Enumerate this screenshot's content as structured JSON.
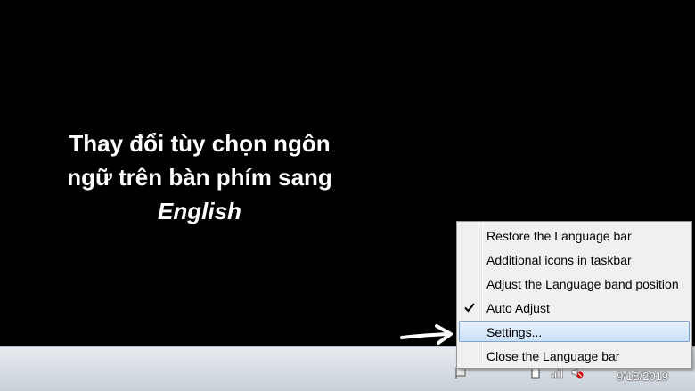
{
  "caption": {
    "line1": "Thay đổi tùy chọn ngôn",
    "line2": "ngữ trên bàn phím sang",
    "line3": "English"
  },
  "context_menu": {
    "items": [
      {
        "label": "Restore the Language bar",
        "checked": false,
        "highlighted": false
      },
      {
        "label": "Additional icons in taskbar",
        "checked": false,
        "highlighted": false
      },
      {
        "label": "Adjust the Language band position",
        "checked": false,
        "highlighted": false
      },
      {
        "label": "Auto Adjust",
        "checked": true,
        "highlighted": false
      },
      {
        "label": "Settings...",
        "checked": false,
        "highlighted": true
      },
      {
        "label": "Close the Language bar",
        "checked": false,
        "highlighted": false
      }
    ]
  },
  "taskbar": {
    "date": "9/18/2019",
    "tray_icons": [
      "flag-icon",
      "battery-icon",
      "network-icon",
      "volume-muted-icon"
    ]
  },
  "colors": {
    "background": "#000000",
    "menu_bg": "#f0f0f0",
    "highlight_border": "#7da2ce",
    "highlight_fill": "#cbe1fa"
  }
}
